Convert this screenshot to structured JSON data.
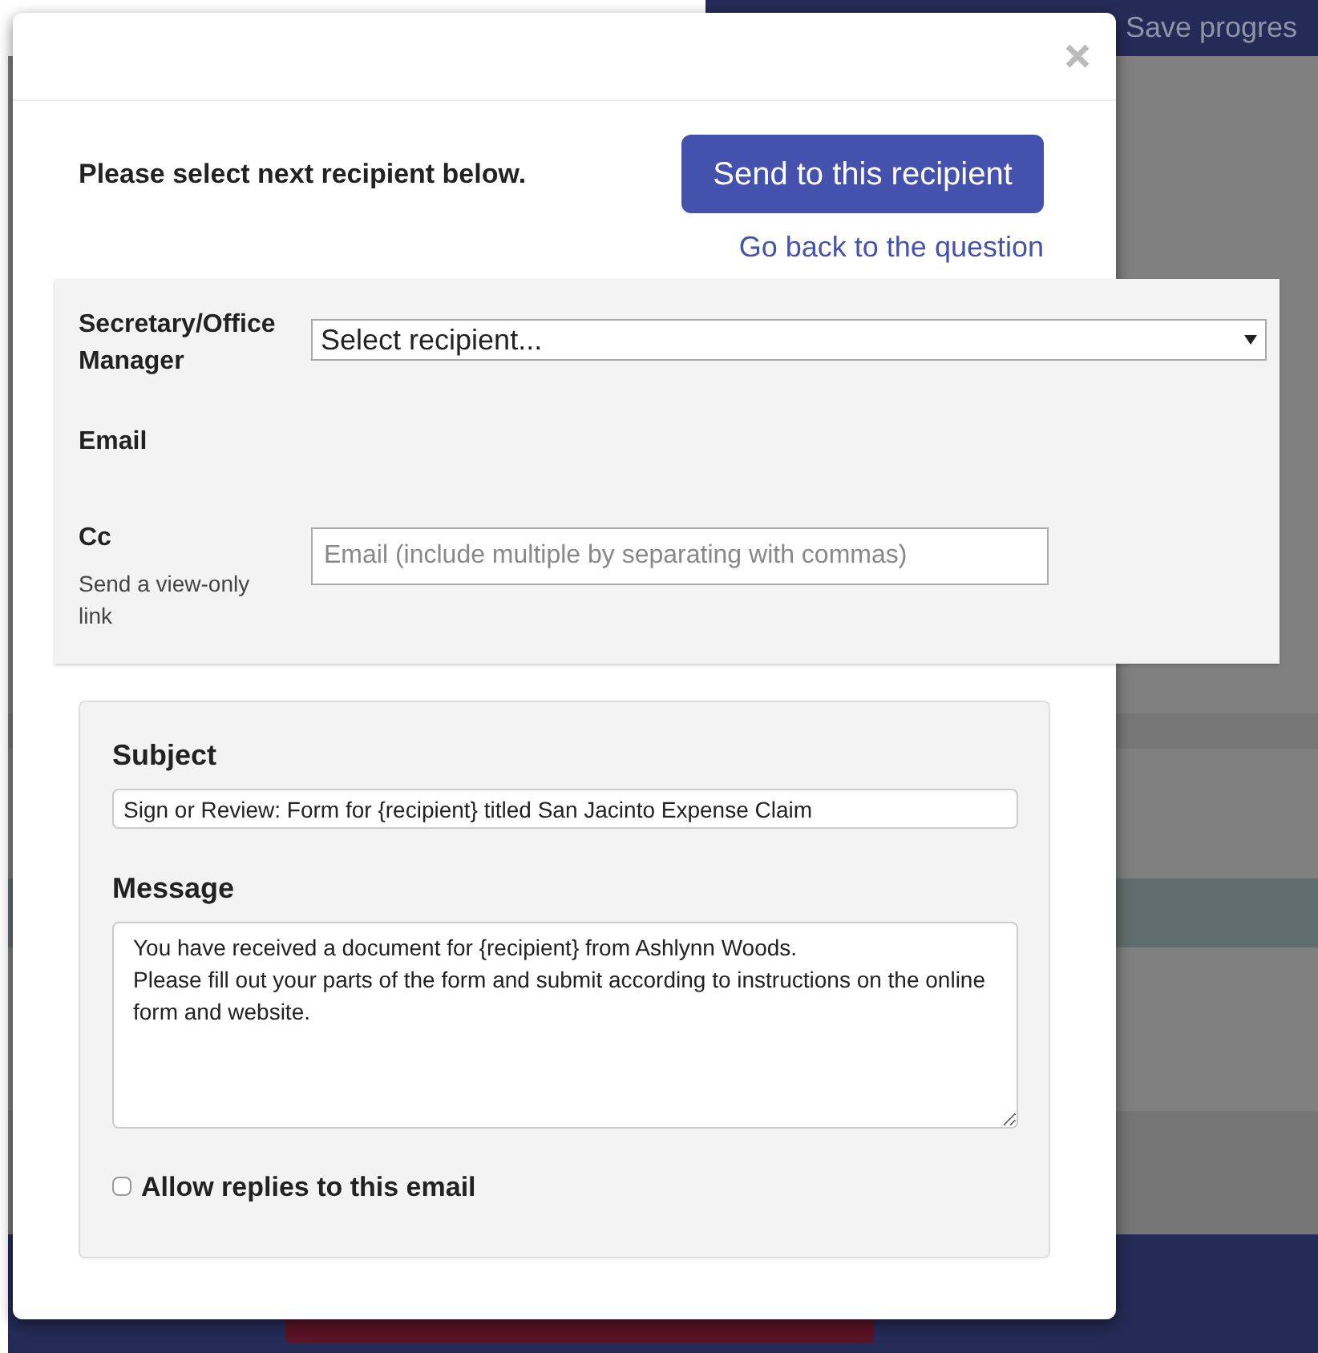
{
  "background": {
    "save_button": "Save progres"
  },
  "modal": {
    "prompt": "Please select next recipient below.",
    "send_button": "Send to this recipient",
    "back_link": "Go back to the question",
    "recipient": {
      "label": "Secretary/Office Manager",
      "value": "Select recipient..."
    },
    "email": {
      "label": "Email"
    },
    "cc": {
      "label": "Cc",
      "hint": "Send a view-only link",
      "placeholder": "Email (include multiple by separating with commas)"
    },
    "subject": {
      "label": "Subject",
      "value": "Sign or Review: Form for {recipient} titled San Jacinto Expense Claim"
    },
    "message": {
      "label": "Message",
      "value": "You have received a document for {recipient} from Ashlynn Woods.\nPlease fill out your parts of the form and submit according to instructions on the online form and website."
    },
    "allow_replies": {
      "label": "Allow replies to this email",
      "checked": false
    }
  }
}
